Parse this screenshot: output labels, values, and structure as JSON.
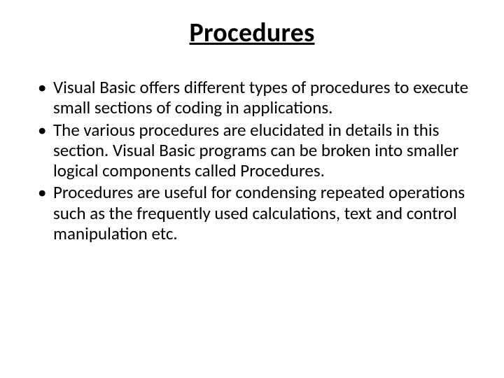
{
  "slide": {
    "title": "Procedures",
    "bullets": [
      "Visual Basic offers different types of procedures to execute small sections of coding in applications.",
      "The various procedures are elucidated in details in this section. Visual Basic programs can be broken into smaller logical components called Procedures.",
      "Procedures are useful for condensing repeated operations such as the frequently used calculations, text and control manipulation etc."
    ]
  }
}
